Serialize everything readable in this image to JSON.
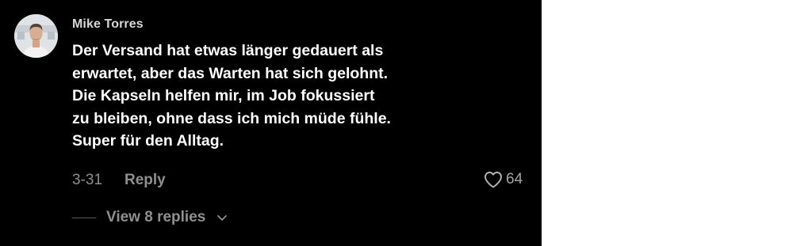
{
  "comment": {
    "username": "Mike Torres",
    "text_lines": [
      "Der Versand hat etwas länger gedauert als",
      "erwartet, aber das Warten hat sich gelohnt.",
      "Die Kapseln helfen mir, im Job fokussiert",
      "zu bleiben, ohne dass ich mich müde fühle.",
      "Super für den Alltag."
    ],
    "date": "3-31",
    "reply_label": "Reply",
    "like_icon": "heart-icon",
    "like_count": "64",
    "view_replies_label": "View 8 replies",
    "view_replies_icon": "chevron-down-icon"
  },
  "colors": {
    "background": "#000000",
    "text_primary": "#ffffff",
    "text_secondary": "#8f8f8f"
  }
}
